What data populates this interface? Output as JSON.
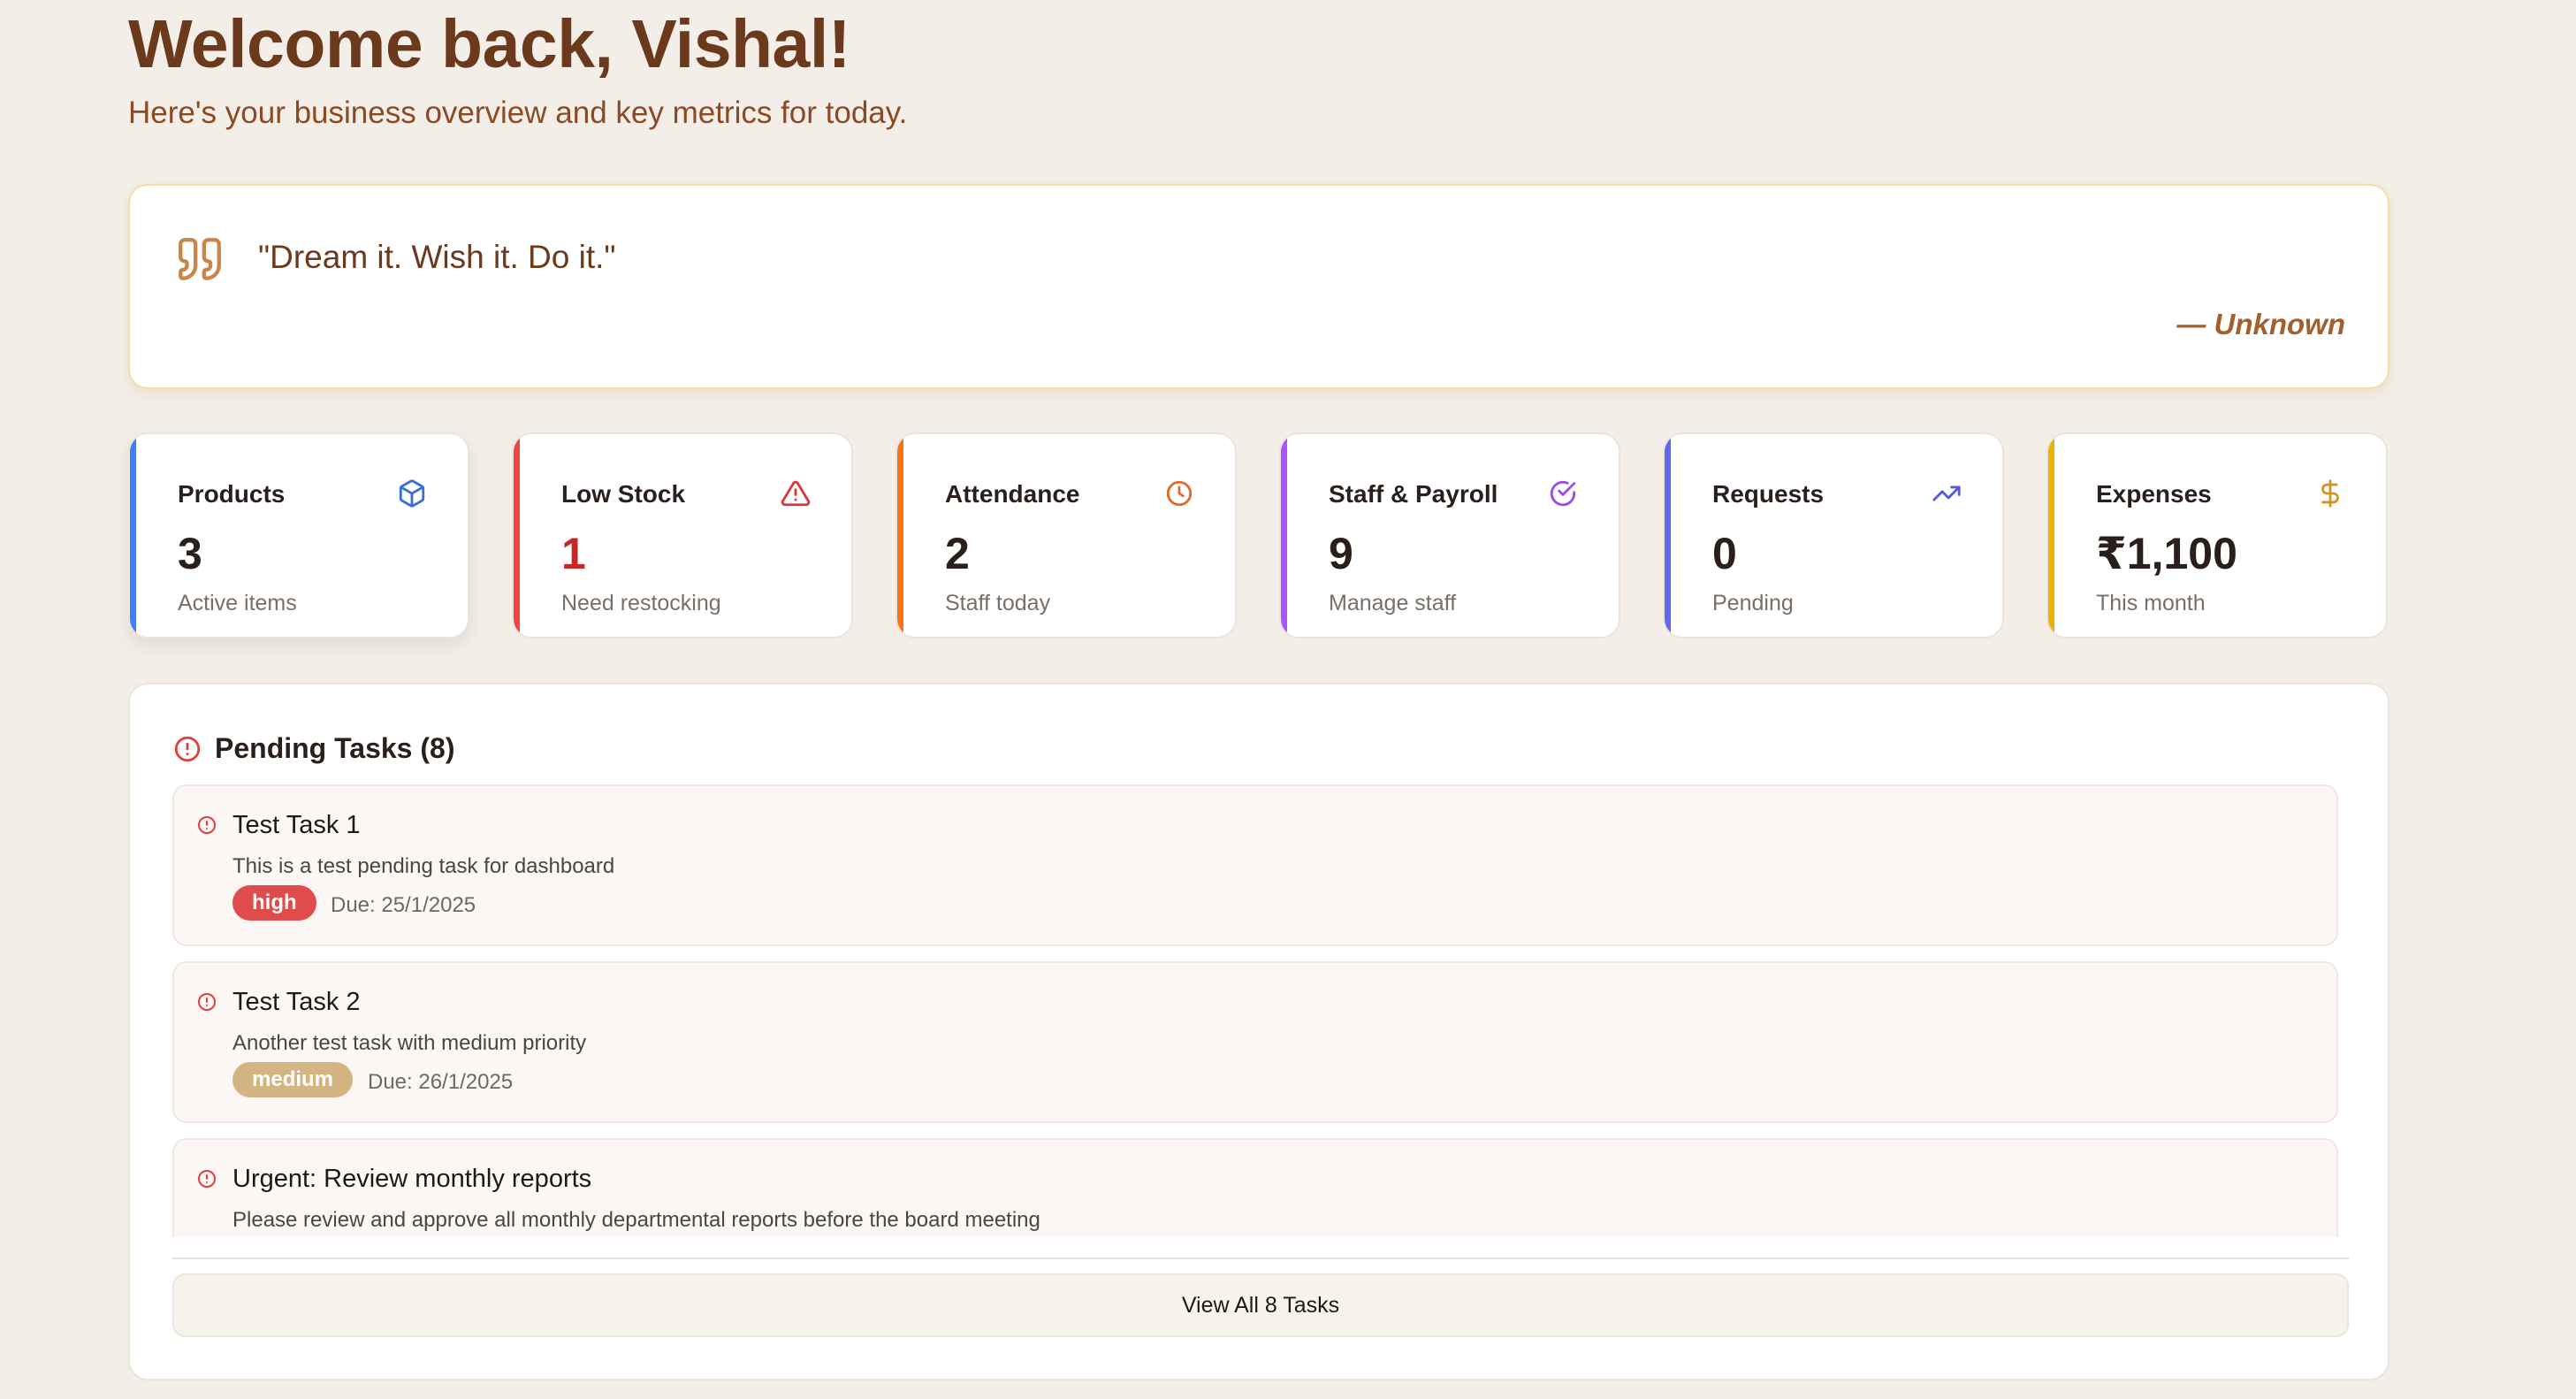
{
  "header": {
    "title": "Welcome back, Vishal!",
    "subtitle": "Here's your business overview and key metrics for today."
  },
  "quote": {
    "icon": "quote-icon",
    "text": "\"Dream it. Wish it. Do it.\"",
    "author": "— Unknown"
  },
  "stats": [
    {
      "title": "Products",
      "value": "3",
      "caption": "Active items",
      "icon": "package-icon",
      "accent": "#3b82f6",
      "value_color": "#2a1f1a"
    },
    {
      "title": "Low Stock",
      "value": "1",
      "caption": "Need restocking",
      "icon": "alert-triangle-icon",
      "accent": "#ef4444",
      "value_color": "#c62828"
    },
    {
      "title": "Attendance",
      "value": "2",
      "caption": "Staff today",
      "icon": "clock-icon",
      "accent": "#f97316",
      "value_color": "#2a1f1a"
    },
    {
      "title": "Staff & Payroll",
      "value": "9",
      "caption": "Manage staff",
      "icon": "check-circle-icon",
      "accent": "#a855f7",
      "value_color": "#2a1f1a"
    },
    {
      "title": "Requests",
      "value": "0",
      "caption": "Pending",
      "icon": "trending-up-icon",
      "accent": "#6366f1",
      "value_color": "#2a1f1a"
    },
    {
      "title": "Expenses",
      "value": "₹1,100",
      "caption": "This month",
      "icon": "dollar-icon",
      "accent": "#eab308",
      "value_color": "#2a1f1a"
    }
  ],
  "tasks": {
    "title": "Pending Tasks (8)",
    "items": [
      {
        "title": "Test Task 1",
        "description": "This is a test pending task for dashboard",
        "priority": "high",
        "priority_color": "#e04b4b",
        "due": "Due: 25/1/2025"
      },
      {
        "title": "Test Task 2",
        "description": "Another test task with medium priority",
        "priority": "medium",
        "priority_color": "#d4b483",
        "due": "Due: 26/1/2025"
      },
      {
        "title": "Urgent: Review monthly reports",
        "description": "Please review and approve all monthly departmental reports before the board meeting",
        "priority": "",
        "priority_color": "",
        "due": ""
      }
    ],
    "view_all_label": "View All 8 Tasks"
  },
  "colors": {
    "background": "#f3efe8",
    "heading": "#6b3a1c",
    "quote_border": "#f3dfa6",
    "alert": "#dc3f3f"
  }
}
